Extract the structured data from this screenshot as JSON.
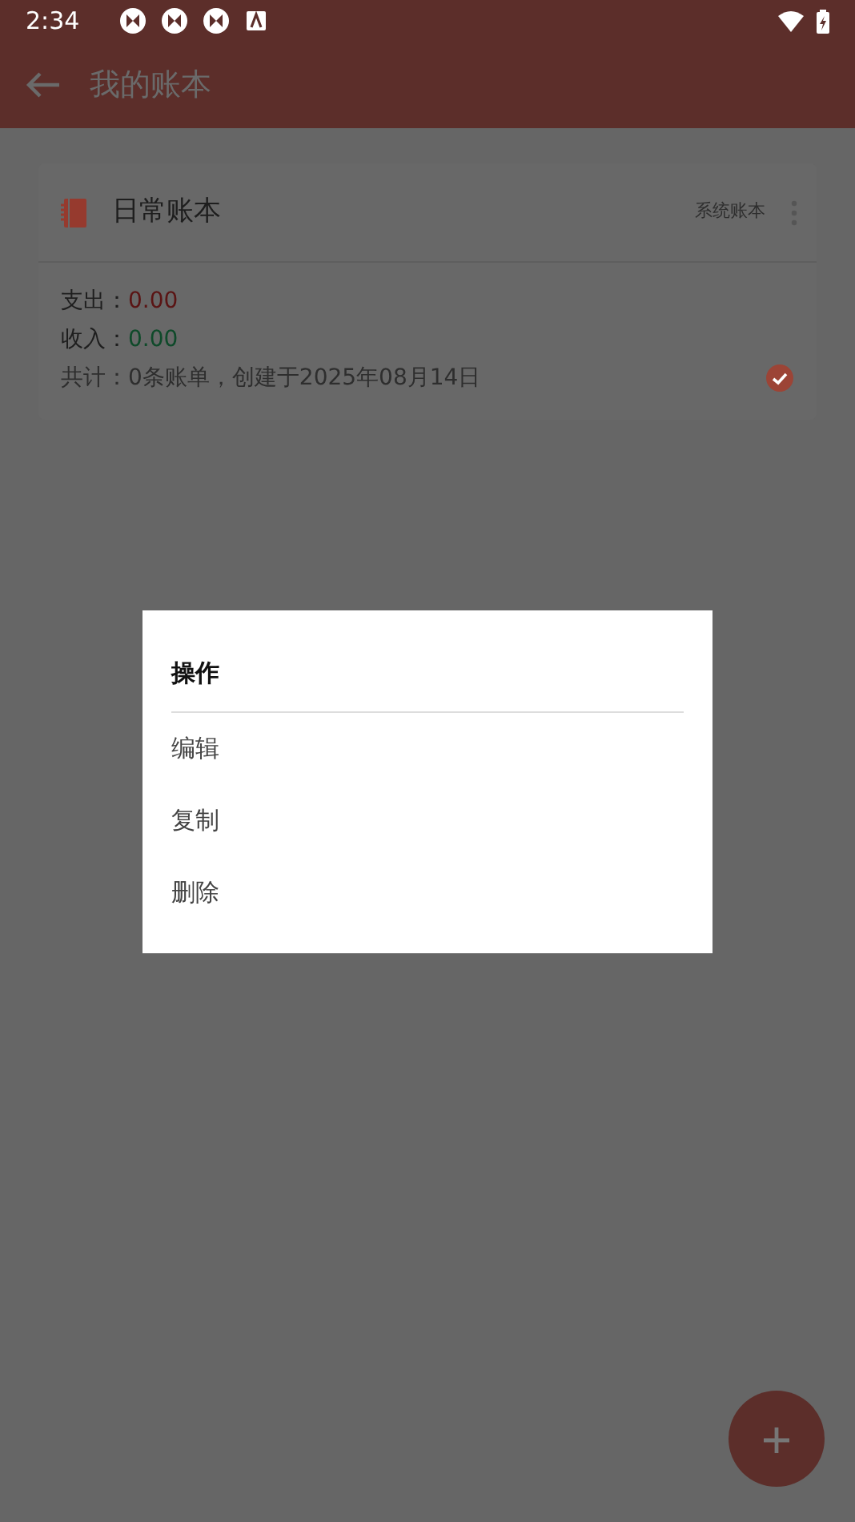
{
  "status_bar": {
    "time": "2:34"
  },
  "app_bar": {
    "title": "我的账本"
  },
  "books": [
    {
      "name": "日常账本",
      "tag": "系统账本",
      "expense_label": "支出：",
      "expense": "0.00",
      "income_label": "收入：",
      "income": "0.00",
      "summary": "共计：0条账单，创建于2025年08月14日",
      "selected": true
    }
  ],
  "dialog": {
    "title": "操作",
    "items": [
      "编辑",
      "复制",
      "删除"
    ]
  }
}
